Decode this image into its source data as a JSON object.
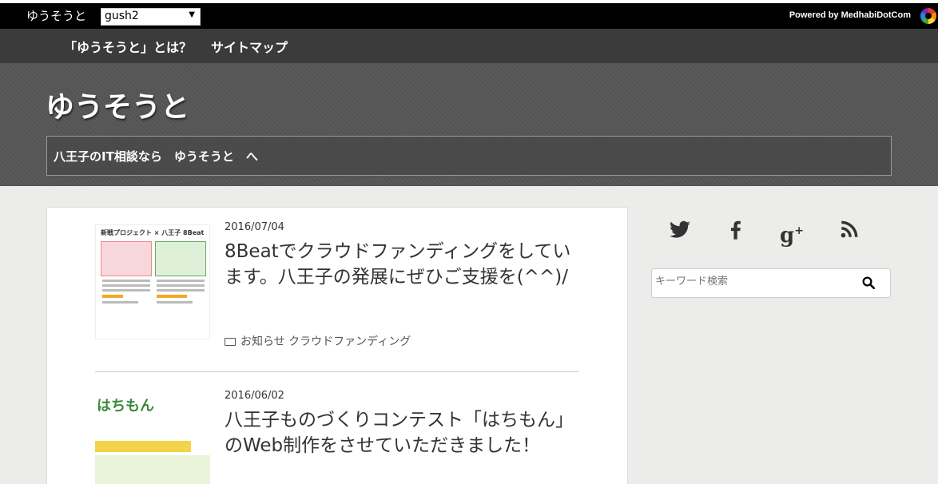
{
  "topbar": {
    "site_name": "ゆうそうと",
    "site_select": "gush2",
    "powered_by": "Powered by MedhabiDotCom"
  },
  "nav": {
    "items": [
      {
        "label": "「ゆうそうと」とは？"
      },
      {
        "label": "サイトマップ"
      }
    ]
  },
  "header": {
    "title": "ゆうそうと",
    "tagline": "八王子のIT相談なら　ゆうそうと　へ"
  },
  "posts": [
    {
      "date": "2016/07/04",
      "title": "8Beatでクラウドファンディングをしています。八王子の発展にぜひご支援を(^^)/",
      "categories": "お知らせ クラウドファンディング",
      "thumb_header": "新戦プロジェクト × 八王子 8Beat"
    },
    {
      "date": "2016/06/02",
      "title": "八王子ものづくりコンテスト「はちもん」のWeb制作をさせていただきました！",
      "thumb_logo": "はちもん"
    }
  ],
  "sidebar": {
    "social": [
      "twitter-icon",
      "facebook-icon",
      "google-plus-icon",
      "rss-icon"
    ],
    "search_placeholder": "キーワード検索"
  }
}
